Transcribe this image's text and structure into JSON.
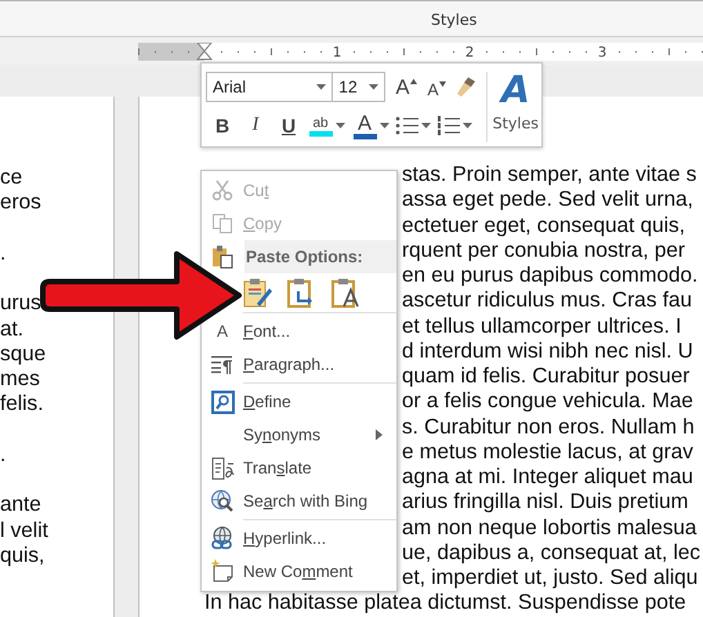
{
  "ribbon": {
    "group_label": "Styles"
  },
  "ruler": {
    "numbers": [
      "1",
      "2",
      "3"
    ]
  },
  "mini_toolbar": {
    "font": "Arial",
    "size": "12",
    "row1": [
      {
        "kind": "grow_font",
        "glyph": "A"
      },
      {
        "kind": "shrink_font",
        "glyph": "A"
      },
      {
        "kind": "format_painter"
      }
    ],
    "row2": [
      {
        "kind": "bold",
        "glyph": "B",
        "dropdown": false
      },
      {
        "kind": "italic",
        "glyph": "I",
        "dropdown": false
      },
      {
        "kind": "underline",
        "glyph": "U",
        "dropdown": false
      },
      {
        "kind": "highlight",
        "glyph": "ab",
        "color": "#00e0ec",
        "dropdown": true
      },
      {
        "kind": "font_color",
        "glyph": "A",
        "color": "#1e5fae",
        "dropdown": true
      },
      {
        "kind": "bullets",
        "dropdown": true
      },
      {
        "kind": "numbering",
        "dropdown": true
      }
    ],
    "styles": {
      "glyph": "A",
      "label": "Styles"
    }
  },
  "left_page": {
    "paragraphs": [
      [
        "ce",
        "eros"
      ],
      [
        "."
      ],
      [
        "urus",
        "at.",
        "sque",
        "mes",
        "felis."
      ],
      [
        "."
      ],
      [
        "ante",
        "l velit",
        "quis,"
      ]
    ]
  },
  "right_page": {
    "lines": [
      "stas. Proin semper, ante vitae s",
      "assa eget pede. Sed velit urna,",
      "ectetuer eget, consequat quis,",
      "rquent per conubia nostra, per",
      "en eu purus dapibus commodo.",
      "ascetur ridiculus mus. Cras fau",
      "et tellus ullamcorper ultrices. I",
      "d interdum wisi nibh nec nisl. U",
      "quam id felis. Curabitur posuer",
      "or a felis congue vehicula. Mae",
      "s. Curabitur non eros. Nullam h",
      "e metus molestie lacus, at grav",
      "agna at mi. Integer aliquet mau",
      "arius fringilla nisl. Duis pretium",
      "am non neque lobortis malesua",
      "ue, dapibus a, consequat at, lec",
      "et, imperdiet ut, justo. Sed aliqu"
    ],
    "full_line": "In hac habitasse platea dictumst. Suspendisse pote"
  },
  "context_menu": {
    "items": [
      {
        "kind": "command",
        "pre": "Cu",
        "key": "t",
        "disabled": true,
        "submenu": false
      },
      {
        "kind": "command",
        "key": "C",
        "post": "opy",
        "disabled": true,
        "submenu": false
      },
      {
        "kind": "header",
        "label": "Paste Options:"
      },
      {
        "kind": "paste_row",
        "options": [
          {
            "kind": "keep_source"
          },
          {
            "kind": "merge"
          },
          {
            "kind": "text_only"
          }
        ]
      },
      {
        "kind": "separator"
      },
      {
        "kind": "command",
        "glyph": "A",
        "key": "F",
        "post": "ont...",
        "disabled": false,
        "submenu": false
      },
      {
        "kind": "command",
        "key": "P",
        "post": "aragraph...",
        "disabled": false,
        "submenu": false
      },
      {
        "kind": "separator"
      },
      {
        "kind": "command",
        "key": "D",
        "post": "efine",
        "disabled": false,
        "submenu": false
      },
      {
        "kind": "command",
        "pre": "Sy",
        "key": "n",
        "post": "onyms",
        "disabled": false,
        "submenu": true
      },
      {
        "kind": "command",
        "pre": "Tran",
        "key": "s",
        "post": "late",
        "disabled": false,
        "submenu": false
      },
      {
        "kind": "command",
        "pre": "Se",
        "key": "a",
        "post": "rch with Bing",
        "disabled": false,
        "submenu": false
      },
      {
        "kind": "separator"
      },
      {
        "kind": "command",
        "key": "H",
        "post": "yperlink...",
        "disabled": false,
        "submenu": false
      },
      {
        "kind": "command",
        "pre": "New Co",
        "key": "m",
        "post": "ment",
        "disabled": false,
        "submenu": false
      }
    ]
  }
}
